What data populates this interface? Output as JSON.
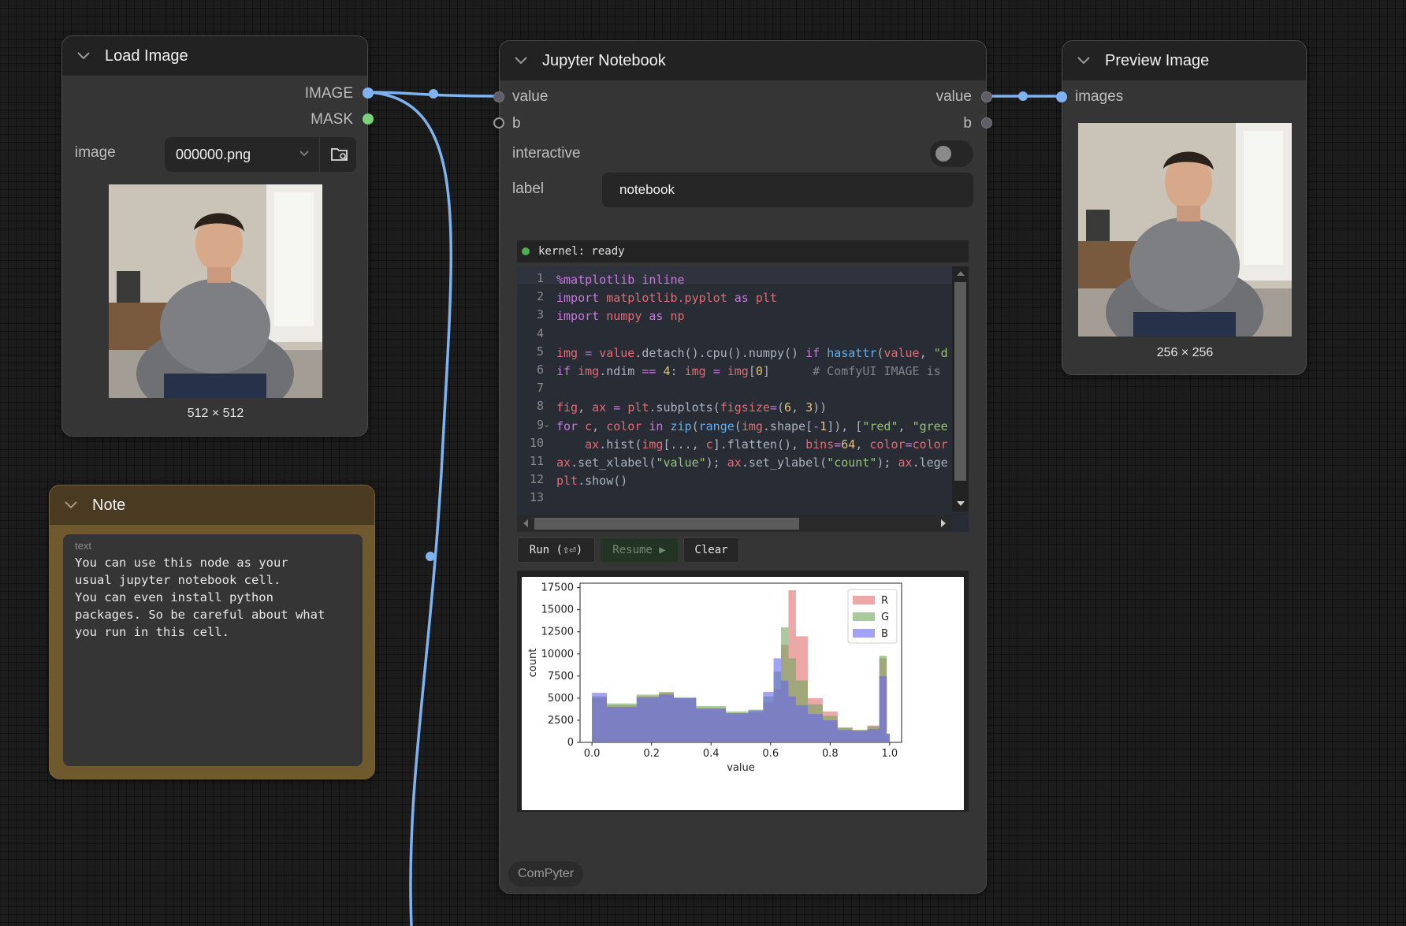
{
  "load_image": {
    "title": "Load Image",
    "outputs": [
      "IMAGE",
      "MASK"
    ],
    "image_label": "image",
    "image_value": "000000.png",
    "caption": "512 × 512"
  },
  "note": {
    "title": "Note",
    "text_label": "text",
    "text": "You can use this node as your\nusual jupyter notebook cell.\nYou can even install python\npackages. So be careful about what\nyou run in this cell."
  },
  "notebook": {
    "title": "Jupyter Notebook",
    "inputs": [
      "value",
      "b"
    ],
    "outputs": [
      "value",
      "b"
    ],
    "interactive_label": "interactive",
    "interactive_on": false,
    "label_label": "label",
    "label_value": "notebook",
    "kernel_status": "kernel: ready",
    "line_numbers": [
      "1",
      "2",
      "3",
      "4",
      "5",
      "6",
      "7",
      "8",
      "9",
      "10",
      "11",
      "12",
      "13"
    ],
    "buttons": {
      "run": "Run (⇧⏎)",
      "resume": "Resume ▶",
      "clear": "Clear"
    },
    "footer_badge": "ComPyter"
  },
  "preview": {
    "title": "Preview Image",
    "input": "images",
    "caption": "256 × 256"
  },
  "colors": {
    "wire": "#7fb2f0",
    "note_bg": "#6f5a2f",
    "kernel_dot": "#4caf50"
  },
  "chart_data": {
    "type": "bar",
    "title": "",
    "xlabel": "value",
    "ylabel": "count",
    "xlim": [
      -0.04,
      1.04
    ],
    "ylim": [
      0,
      18000
    ],
    "xticks": [
      "0.0",
      "0.2",
      "0.4",
      "0.6",
      "0.8",
      "1.0"
    ],
    "yticks": [
      "0",
      "2500",
      "5000",
      "7500",
      "10000",
      "12500",
      "15000",
      "17500"
    ],
    "legend_position": "top-right",
    "x": [
      0.0,
      0.1,
      0.2,
      0.25,
      0.3,
      0.4,
      0.5,
      0.55,
      0.6,
      0.62,
      0.65,
      0.67,
      0.7,
      0.75,
      0.8,
      0.85,
      0.9,
      0.95,
      0.98,
      1.0
    ],
    "series": [
      {
        "name": "R",
        "color": "#e06c6c",
        "values": [
          5000,
          4200,
          5200,
          5600,
          5000,
          3900,
          3300,
          3400,
          4500,
          6000,
          11000,
          17200,
          12000,
          5000,
          3500,
          1700,
          1400,
          1900,
          9500,
          1000
        ]
      },
      {
        "name": "G",
        "color": "#6fa65c",
        "values": [
          5200,
          4400,
          5400,
          5700,
          5100,
          4100,
          3500,
          3700,
          5200,
          8000,
          13000,
          9500,
          7000,
          4300,
          3000,
          1600,
          1400,
          1800,
          9800,
          1000
        ]
      },
      {
        "name": "B",
        "color": "#6464f0",
        "values": [
          5600,
          4000,
          5100,
          5400,
          5000,
          3800,
          3300,
          3600,
          5700,
          9500,
          7000,
          5200,
          4200,
          3200,
          2500,
          1400,
          1300,
          1500,
          7500,
          900
        ]
      }
    ]
  }
}
